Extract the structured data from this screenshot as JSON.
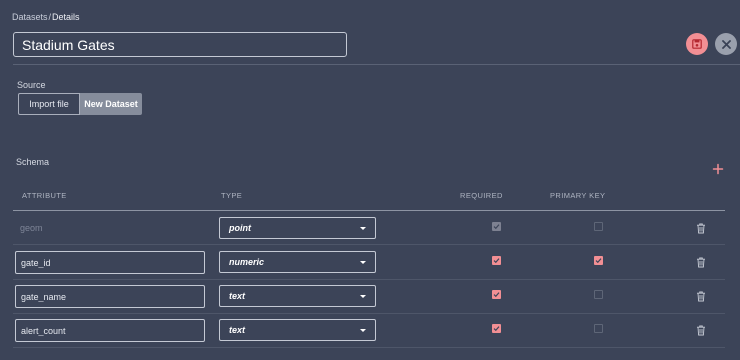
{
  "breadcrumb": {
    "root": "Datasets",
    "separator": "/",
    "current": "Details"
  },
  "title_input": {
    "value": "Stadium Gates"
  },
  "source": {
    "label": "Source",
    "options": [
      "Import file",
      "New Dataset"
    ],
    "selected": "New Dataset"
  },
  "schema": {
    "label": "Schema",
    "columns": {
      "attribute": "ATTRIBUTE",
      "type": "TYPE",
      "required": "REQUIRED",
      "primary_key": "PRIMARY KEY"
    },
    "rows": [
      {
        "attribute": "geom",
        "editable": false,
        "type": "point",
        "required": true,
        "required_disabled": true,
        "primary_key": false
      },
      {
        "attribute": "gate_id",
        "editable": true,
        "type": "numeric",
        "required": true,
        "required_disabled": false,
        "primary_key": true
      },
      {
        "attribute": "gate_name",
        "editable": true,
        "type": "text",
        "required": true,
        "required_disabled": false,
        "primary_key": false
      },
      {
        "attribute": "alert_count",
        "editable": true,
        "type": "text",
        "required": true,
        "required_disabled": false,
        "primary_key": false
      }
    ]
  },
  "colors": {
    "accent": "#f28f94",
    "background": "#3c4458",
    "close_button": "#9aa0ad"
  },
  "icons": {
    "save": "save-icon",
    "close": "close-icon",
    "add": "plus-icon",
    "delete": "trash-icon",
    "dropdown": "caret-down-icon"
  }
}
